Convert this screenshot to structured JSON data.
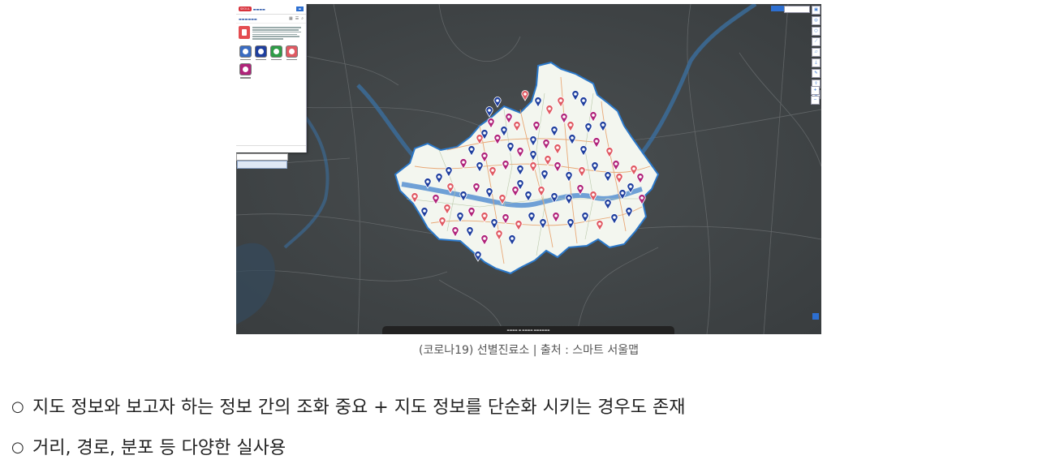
{
  "map": {
    "marker_colors": {
      "blue": "#1f3f9e",
      "magenta": "#b0247a",
      "red": "#e05a63"
    },
    "seoul_fill": "#f3f6ef",
    "basemap_color": "#3f4446",
    "river_color": "#3b6e9e"
  },
  "caption": "(코로나19) 선별진료소 | 출처 : 스마트 서울맵",
  "bullets": [
    "지도 정보와 보고자 하는 정보 간의 조화 중요 + 지도 정보를 단순화 시키는 경우도 존재",
    "거리, 경로, 분포 등 다양한 실사용"
  ],
  "bullet_mark": "○",
  "toolbar": {
    "icons": [
      "map-icon",
      "compass-icon",
      "circle-icon",
      "ruler-icon",
      "area-icon",
      "download-icon",
      "pen-icon",
      "share-icon",
      "print-icon"
    ]
  },
  "zoom": {
    "plus": "+",
    "minus": "−"
  },
  "panel": {
    "categories": [
      {
        "name": "category-all",
        "color": "#3a6cc2"
      },
      {
        "name": "category-clinic-blue",
        "color": "#1f3f9e"
      },
      {
        "name": "category-clinic-green",
        "color": "#2f9c47"
      },
      {
        "name": "category-clinic-red",
        "color": "#e05a63"
      },
      {
        "name": "category-clinic-magenta",
        "color": "#b0247a"
      }
    ]
  }
}
